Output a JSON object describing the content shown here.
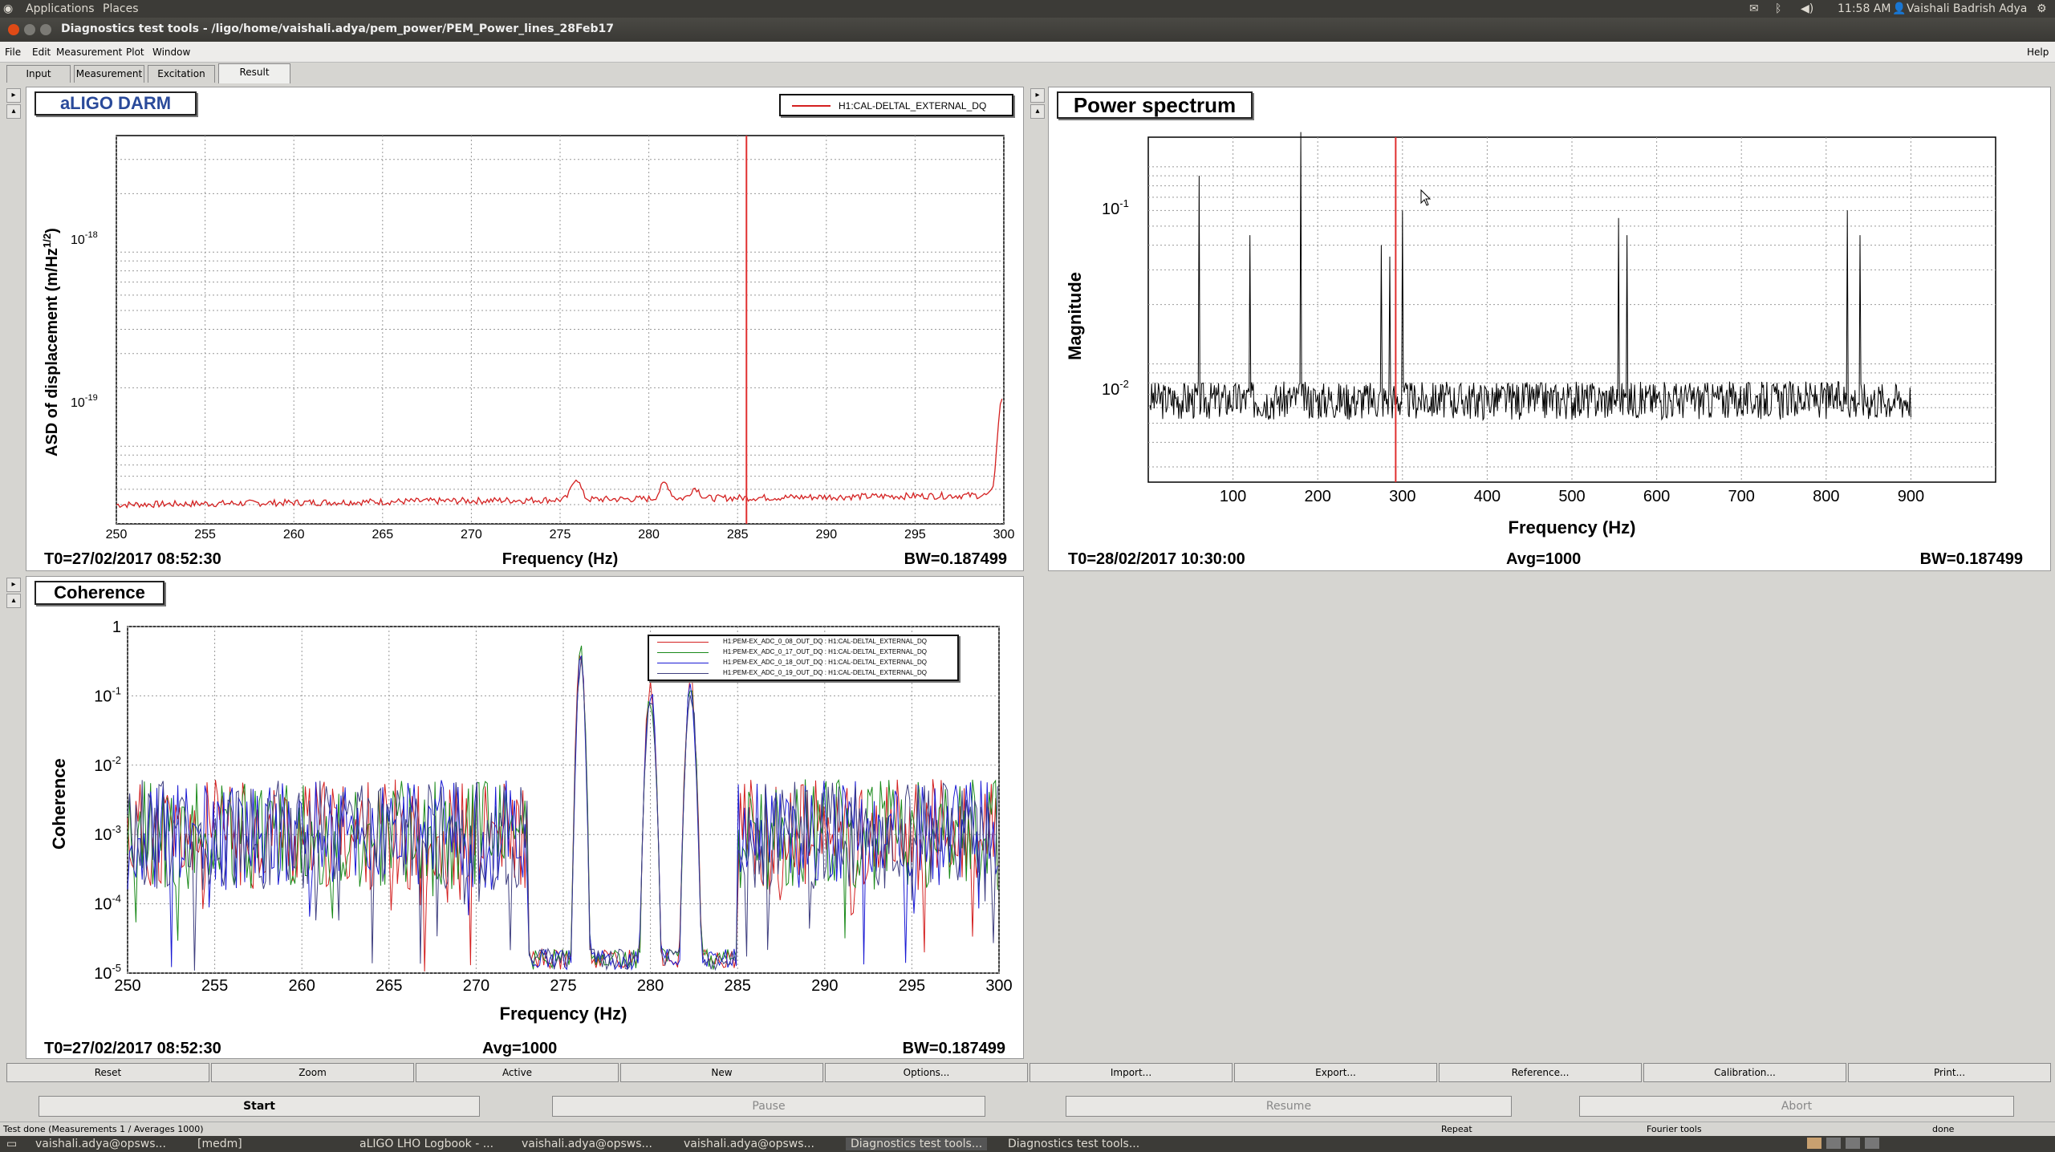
{
  "topbar": {
    "apps": "Applications",
    "places": "Places",
    "time": "11:58 AM",
    "user": "Vaishali Badrish Adya"
  },
  "window": {
    "title": "Diagnostics test tools - /ligo/home/vaishali.adya/pem_power/PEM_Power_lines_28Feb17"
  },
  "menu": {
    "file": "File",
    "edit": "Edit",
    "measurement": "Measurement",
    "plot": "Plot",
    "window": "Window",
    "help": "Help"
  },
  "tabs": [
    "Input",
    "Measurement",
    "Excitation",
    "Result"
  ],
  "panels": {
    "darm": {
      "title": "aLIGO DARM",
      "t0": "T0=27/02/2017 08:52:30",
      "bw": "BW=0.187499",
      "xlabel": "Frequency (Hz)",
      "ylabel": "ASD of displacement (m/Hz^1/2)",
      "legend": "H1:CAL-DELTAL_EXTERNAL_DQ"
    },
    "power": {
      "title": "Power spectrum",
      "t0": "T0=28/02/2017 10:30:00",
      "avg": "Avg=1000",
      "bw": "BW=0.187499",
      "xlabel": "Frequency (Hz)",
      "ylabel": "Magnitude"
    },
    "coherence": {
      "title": "Coherence",
      "t0": "T0=27/02/2017 08:52:30",
      "avg": "Avg=1000",
      "bw": "BW=0.187499",
      "xlabel": "Frequency (Hz)",
      "ylabel": "Coherence",
      "legend": [
        "H1:PEM-EX_ADC_0_08_OUT_DQ : H1:CAL-DELTAL_EXTERNAL_DQ",
        "H1:PEM-EX_ADC_0_17_OUT_DQ : H1:CAL-DELTAL_EXTERNAL_DQ",
        "H1:PEM-EX_ADC_0_18_OUT_DQ : H1:CAL-DELTAL_EXTERNAL_DQ",
        "H1:PEM-EX_ADC_0_19_OUT_DQ : H1:CAL-DELTAL_EXTERNAL_DQ"
      ]
    }
  },
  "plot_buttons": [
    "Reset",
    "Zoom",
    "Active",
    "New",
    "Options...",
    "Import...",
    "Export...",
    "Reference...",
    "Calibration...",
    "Print..."
  ],
  "control_buttons": [
    "Start",
    "Pause",
    "Resume",
    "Abort"
  ],
  "status": {
    "left": "Test done (Measurements 1 / Averages 1000)",
    "mode": "Repeat",
    "tool": "Fourier tools",
    "state": "done"
  },
  "taskbar": [
    "vaishali.adya@opsws...",
    "[medm]",
    "aLIGO LHO Logbook - ...",
    "vaishali.adya@opsws...",
    "vaishali.adya@opsws...",
    "Diagnostics test tools...",
    "Diagnostics test tools..."
  ],
  "colors": {
    "series1": "#d42020",
    "series2": "#1a8a1a",
    "series3": "#1a1ad4",
    "series4": "#404080",
    "cursor": "#e03030"
  },
  "chart_data": [
    {
      "type": "line",
      "title": "aLIGO DARM",
      "xlabel": "Frequency (Hz)",
      "ylabel": "ASD of displacement (m/Hz^1/2)",
      "xlim": [
        250,
        300
      ],
      "yscale": "log",
      "x_ticks": [
        250,
        255,
        260,
        265,
        270,
        275,
        280,
        285,
        290,
        295,
        300
      ],
      "y_ticks": [
        "10^-19",
        "10^-18"
      ],
      "cursor_x": 285.5,
      "series": [
        {
          "name": "H1:CAL-DELTAL_EXTERNAL_DQ",
          "baseline": 5e-20,
          "peaks": [
            [
              275.9,
              6.5e-20
            ],
            [
              280.9,
              6.1e-20
            ],
            [
              282.6,
              5.7e-20
            ],
            [
              299.9,
              1.7e-19
            ]
          ]
        }
      ]
    },
    {
      "type": "line",
      "title": "Power spectrum",
      "xlabel": "Frequency (Hz)",
      "ylabel": "Magnitude",
      "xlim": [
        0,
        1000
      ],
      "yscale": "log",
      "x_ticks": [
        100,
        200,
        300,
        400,
        500,
        600,
        700,
        800,
        900
      ],
      "y_ticks": [
        "10^-2",
        "10^-1"
      ],
      "cursor_x": 292,
      "series": [
        {
          "baseline": 0.0065,
          "peaks": [
            [
              60,
              0.09
            ],
            [
              120,
              0.045
            ],
            [
              180,
              0.15
            ],
            [
              275,
              0.04
            ],
            [
              285,
              0.035
            ],
            [
              300,
              0.06
            ],
            [
              555,
              0.055
            ],
            [
              565,
              0.045
            ],
            [
              825,
              0.06
            ],
            [
              840,
              0.045
            ]
          ]
        }
      ]
    },
    {
      "type": "line",
      "title": "Coherence",
      "xlabel": "Frequency (Hz)",
      "ylabel": "Coherence",
      "xlim": [
        250,
        300
      ],
      "ylim": [
        1e-05,
        1
      ],
      "yscale": "log",
      "x_ticks": [
        250,
        255,
        260,
        265,
        270,
        275,
        280,
        285,
        290,
        295,
        300
      ],
      "y_ticks": [
        "10^-5",
        "10^-4",
        "10^-3",
        "10^-2",
        "10^-1",
        "1"
      ],
      "series": [
        {
          "name": "H1:PEM-EX_ADC_0_08_OUT_DQ : H1:CAL-DELTAL_EXTERNAL_DQ",
          "peaks": [
            [
              276,
              0.45
            ],
            [
              280,
              0.12
            ],
            [
              282.3,
              0.15
            ]
          ]
        },
        {
          "name": "H1:PEM-EX_ADC_0_17_OUT_DQ : H1:CAL-DELTAL_EXTERNAL_DQ",
          "peaks": [
            [
              276,
              0.4
            ],
            [
              280,
              0.1
            ],
            [
              282.3,
              0.13
            ]
          ]
        },
        {
          "name": "H1:PEM-EX_ADC_0_18_OUT_DQ : H1:CAL-DELTAL_EXTERNAL_DQ",
          "peaks": [
            [
              276,
              0.3
            ],
            [
              280,
              0.12
            ],
            [
              282.3,
              0.12
            ]
          ]
        },
        {
          "name": "H1:PEM-EX_ADC_0_19_OUT_DQ : H1:CAL-DELTAL_EXTERNAL_DQ",
          "peaks": [
            [
              276,
              0.3
            ],
            [
              280,
              0.1
            ],
            [
              282.3,
              0.12
            ]
          ]
        }
      ]
    }
  ]
}
